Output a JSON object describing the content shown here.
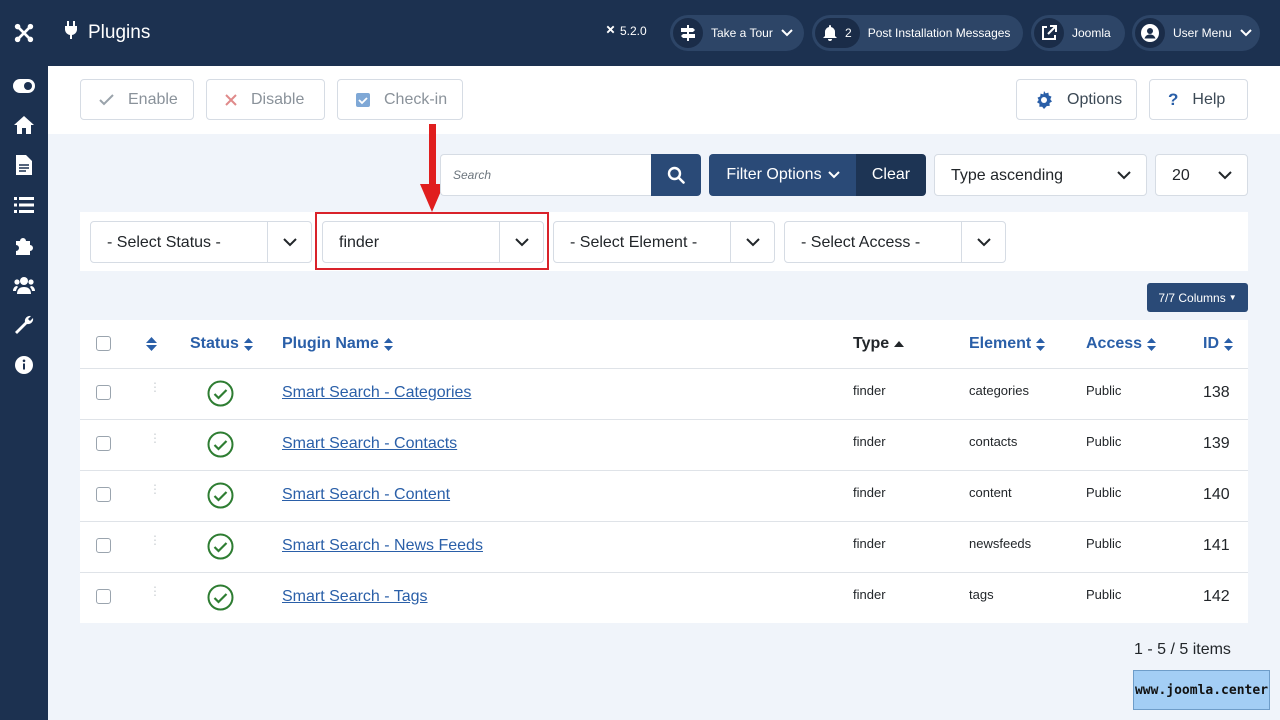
{
  "header": {
    "title": "Plugins",
    "version": "5.2.0",
    "take_tour": "Take a Tour",
    "post_install_count": "2",
    "post_install_label": "Post Installation Messages",
    "site_link": "Joomla",
    "user_menu": "User Menu"
  },
  "toolbar": {
    "enable": "Enable",
    "disable": "Disable",
    "checkin": "Check-in",
    "options": "Options",
    "help": "Help"
  },
  "search": {
    "placeholder": "Search",
    "filter_options": "Filter Options",
    "clear": "Clear",
    "ordering": "Type ascending",
    "limit": "20"
  },
  "filters": {
    "status": "- Select Status -",
    "type": "finder",
    "element": "- Select Element -",
    "access": "- Select Access -"
  },
  "columns_button": "7/7 Columns",
  "table": {
    "headers": {
      "status": "Status",
      "name": "Plugin Name",
      "type": "Type",
      "element": "Element",
      "access": "Access",
      "id": "ID"
    },
    "rows": [
      {
        "name": "Smart Search - Categories",
        "type": "finder",
        "element": "categories",
        "access": "Public",
        "id": "138"
      },
      {
        "name": "Smart Search - Contacts",
        "type": "finder",
        "element": "contacts",
        "access": "Public",
        "id": "139"
      },
      {
        "name": "Smart Search - Content",
        "type": "finder",
        "element": "content",
        "access": "Public",
        "id": "140"
      },
      {
        "name": "Smart Search - News Feeds",
        "type": "finder",
        "element": "newsfeeds",
        "access": "Public",
        "id": "141"
      },
      {
        "name": "Smart Search - Tags",
        "type": "finder",
        "element": "tags",
        "access": "Public",
        "id": "142"
      }
    ]
  },
  "pagination": "1 - 5 / 5 items",
  "watermark": "www.joomla.center",
  "colors": {
    "navy": "#1c3150",
    "accent": "#2a4a77",
    "link": "#2a5fa8",
    "enabled": "#2e7d32",
    "highlight": "#d9222a"
  }
}
